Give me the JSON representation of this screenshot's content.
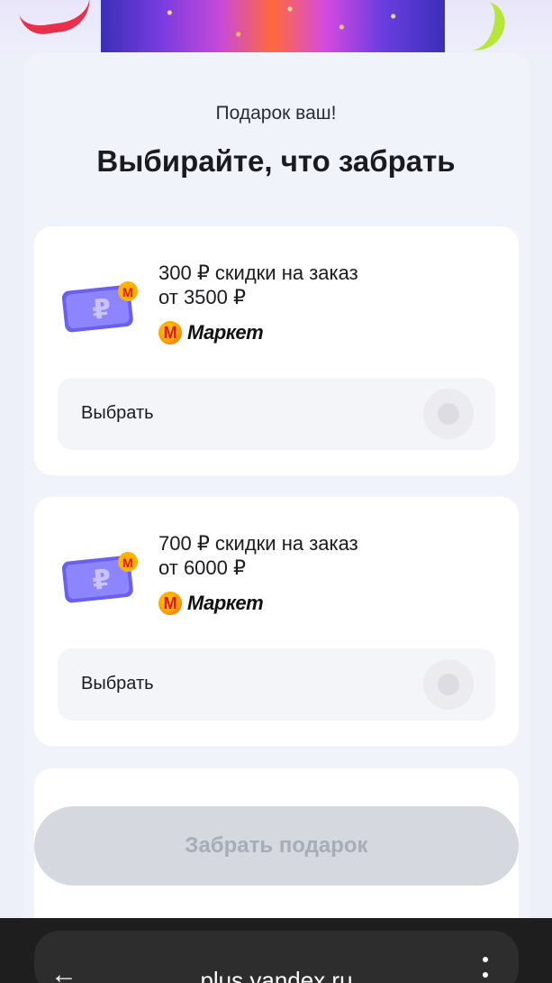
{
  "header": {
    "subtitle": "Подарок ваш!",
    "title": "Выбирайте, что забрать"
  },
  "offers": [
    {
      "text_line1": "300 ₽ скидки на заказ",
      "text_line2": "от 3500 ₽",
      "brand": "Маркет",
      "brand_badge": "M",
      "choose_label": "Выбрать",
      "selected": false
    },
    {
      "text_line1": "700 ₽ скидки на заказ",
      "text_line2": "от 6000 ₽",
      "brand": "Маркет",
      "brand_badge": "M",
      "choose_label": "Выбрать",
      "selected": false
    }
  ],
  "cta": {
    "label": "Забрать подарок",
    "enabled": false
  },
  "browser": {
    "url": "plus.yandex.ru",
    "back_icon": "arrow-left-icon",
    "menu_icon": "more-vertical-icon"
  },
  "colors": {
    "background": "#eef0f9",
    "card": "#ffffff",
    "cta_disabled": "#d5d8de",
    "cta_text_disabled": "#a7adb6",
    "market_red": "#e0131c",
    "market_yellow": "#ffd400"
  }
}
